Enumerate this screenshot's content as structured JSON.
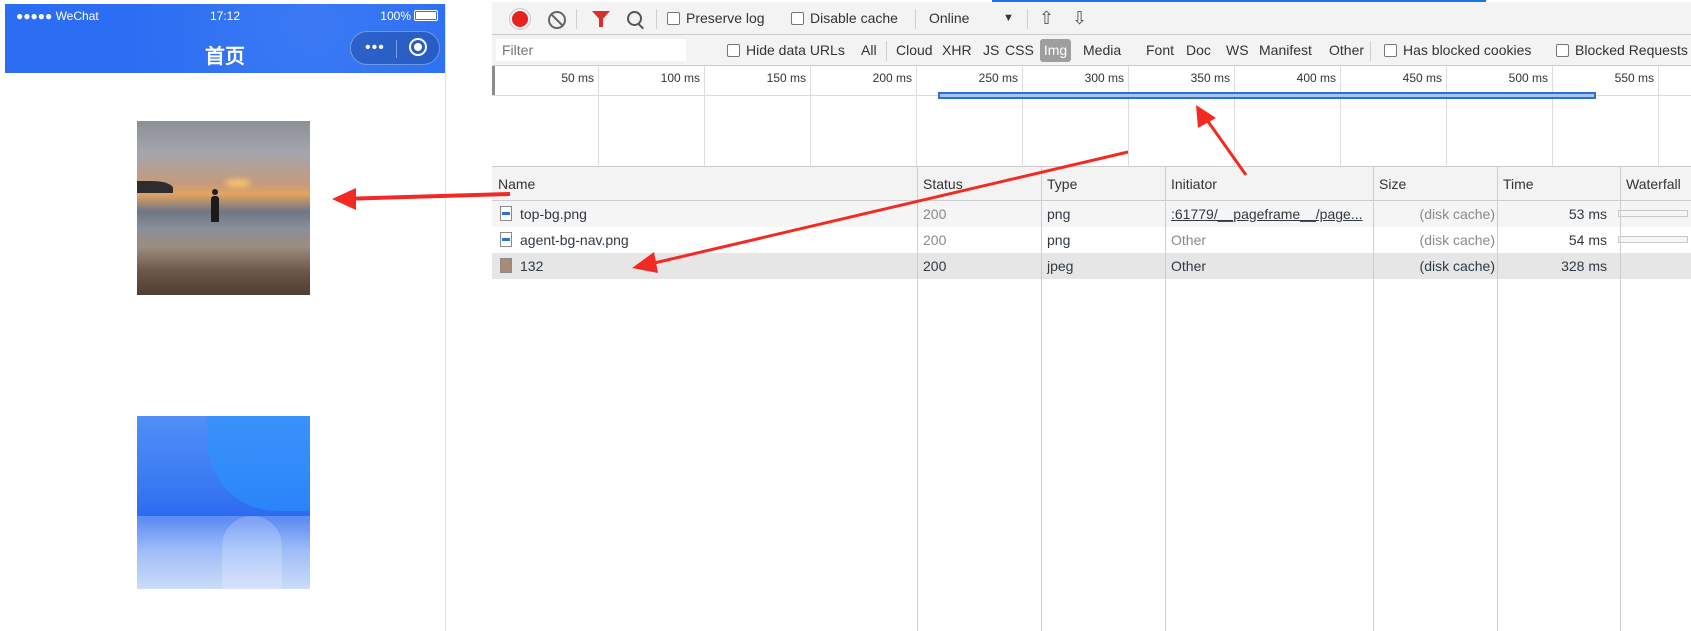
{
  "phone": {
    "status": {
      "carrier": "●●●●● WeChat",
      "wifi_icon": "wifi-icon",
      "time": "17:12",
      "battery": "100%"
    },
    "title": "首页",
    "capsule": {
      "more_icon": "more-dots-icon",
      "more_label": "•••",
      "close_icon": "target-icon"
    },
    "images": [
      {
        "name": "beach-photo",
        "description_icon": "image"
      },
      {
        "name": "blue-gradient-image",
        "description_icon": "image"
      }
    ],
    "colors": {
      "header": "#2b6ef3"
    }
  },
  "devtools": {
    "toolbar": {
      "record_icon": "record-icon",
      "clear_icon": "clear-icon",
      "filter_icon": "filter-icon",
      "search_icon": "search-icon",
      "preserve_log": "Preserve log",
      "disable_cache": "Disable cache",
      "throttle": "Online",
      "throttle_caret": "▼",
      "upload_icon": "⇧",
      "download_icon": "⇩"
    },
    "filterbar": {
      "placeholder": "Filter",
      "hide_data_urls": "Hide data URLs",
      "types": [
        "All",
        "Cloud",
        "XHR",
        "JS",
        "CSS",
        "Img",
        "Media",
        "Font",
        "Doc",
        "WS",
        "Manifest",
        "Other"
      ],
      "selected_type": "Img",
      "has_blocked_cookies": "Has blocked cookies",
      "blocked_requests": "Blocked Requests"
    },
    "overview": {
      "ticks": [
        "50 ms",
        "100 ms",
        "150 ms",
        "200 ms",
        "250 ms",
        "300 ms",
        "350 ms",
        "400 ms",
        "450 ms",
        "500 ms",
        "550 ms"
      ]
    },
    "columns": [
      "Name",
      "Status",
      "Type",
      "Initiator",
      "Size",
      "Time",
      "Waterfall"
    ],
    "rows": [
      {
        "name": "top-bg.png",
        "icon": "png-file-icon",
        "status": "200",
        "type": "png",
        "initiator": ":61779/__pageframe__/page...",
        "size": "(disk cache)",
        "time": "53 ms"
      },
      {
        "name": "agent-bg-nav.png",
        "icon": "png-file-icon",
        "status": "200",
        "type": "png",
        "initiator": "Other",
        "size": "(disk cache)",
        "time": "54 ms"
      },
      {
        "name": "132",
        "icon": "jpeg-file-icon",
        "status": "200",
        "type": "jpeg",
        "initiator": "Other",
        "size": "(disk cache)",
        "time": "328 ms"
      }
    ],
    "colors": {
      "record": "#e8221f",
      "filter": "#d9302a",
      "selection": "#2f6ed6",
      "annotation_arrow": "#f22a23"
    }
  }
}
